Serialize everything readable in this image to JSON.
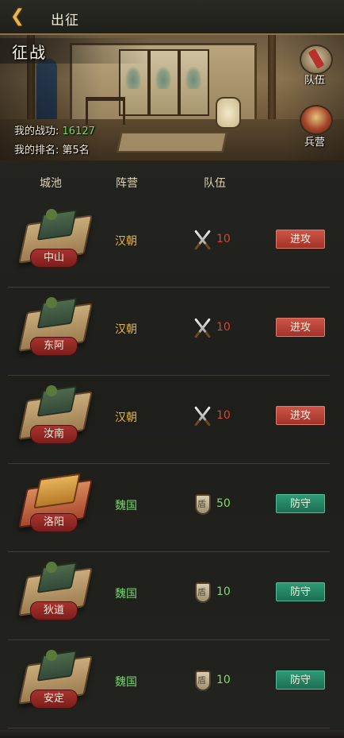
{
  "topbar": {
    "title": "出征"
  },
  "hero": {
    "title": "征战",
    "power_label": "我的战功:",
    "power_value": "16127",
    "rank_label": "我的排名:",
    "rank_value": "第5名",
    "team_button": "队伍",
    "barracks_button": "兵营"
  },
  "list": {
    "headers": {
      "city": "城池",
      "camp": "阵营",
      "team": "队伍"
    },
    "rows": [
      {
        "city": "中山",
        "camp": "汉朝",
        "team_icon": "crossed-swords-icon",
        "team_count": "10",
        "action": "进攻"
      },
      {
        "city": "东阿",
        "camp": "汉朝",
        "team_icon": "crossed-swords-icon",
        "team_count": "10",
        "action": "进攻"
      },
      {
        "city": "汝南",
        "camp": "汉朝",
        "team_icon": "crossed-swords-icon",
        "team_count": "10",
        "action": "进攻"
      },
      {
        "city": "洛阳",
        "camp": "魏国",
        "team_icon": "shield-icon",
        "team_count": "50",
        "action": "防守"
      },
      {
        "city": "狄道",
        "camp": "魏国",
        "team_icon": "shield-icon",
        "team_count": "10",
        "action": "防守"
      },
      {
        "city": "安定",
        "camp": "魏国",
        "team_icon": "shield-icon",
        "team_count": "10",
        "action": "防守"
      }
    ]
  },
  "colors": {
    "han_camp": "#e5b44e",
    "wei_camp": "#76d56e",
    "attack_button": "#b8423a",
    "defend_button": "#27876a",
    "attack_count": "#e0402f",
    "defend_count": "#7ddc6a"
  }
}
